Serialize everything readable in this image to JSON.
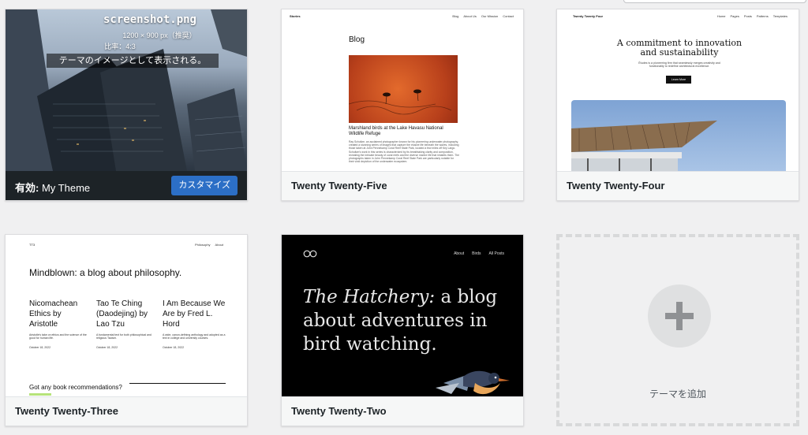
{
  "colors": {
    "active_bar": "#1d2327",
    "customize_button": "#2c6fc6",
    "page_bg": "#f0f0f1"
  },
  "themes": [
    {
      "active_label": "有効:",
      "name": "My Theme",
      "customize_label": "カスタマイズ",
      "screenshot": {
        "filename": "screenshot.png",
        "size_line": "1200 × 900 px（推奨）",
        "ratio_line": "比率：4:3",
        "note": "テーマのイメージとして表示される。"
      }
    },
    {
      "name": "Twenty Twenty-Five",
      "screenshot": {
        "site_title": "Stories",
        "nav": [
          "Blog",
          "About Us",
          "Our Mission",
          "Contact"
        ],
        "heading": "Blog",
        "post_title": "Marshland birds at the Lake Havasu National Wildlife Refuge",
        "excerpt": "Ray Schultze, an acclaimed photographer known for his pioneering underwater photography, created a stunning series of images that capture the elusive life beneath the waves, including those taken at John Pennekamp Coral Reef State Park, located a few miles off Key Largo. Schultze's work in this series is characterized by its breathtaking clarity and composition, revealing the intricate beauty of coral reefs and the diverse marine life that inhabits them. The photographs taken in John Pennekamp Coral Reef State Park are particularly notable for their vivid depiction of the underwater ecosystem."
      }
    },
    {
      "name": "Twenty Twenty-Four",
      "screenshot": {
        "site_title": "Twenty Twenty Four",
        "nav": [
          "Home",
          "Pages",
          "Posts",
          "Patterns",
          "Templates"
        ],
        "headline": "A commitment to innovation and sustainability",
        "sub": "Études is a pioneering firm that seamlessly merges creativity and functionality to redefine architectural excellence.",
        "button": "Learn More"
      }
    },
    {
      "name": "Twenty Twenty-Three",
      "screenshot": {
        "site_title": "TT3",
        "nav": [
          "Philosophy",
          "About"
        ],
        "headline": "Mindblown: a blog about philosophy.",
        "posts": [
          {
            "title": "Nicomachean Ethics by Aristotle",
            "excerpt": "Aristotle's take on ethics and the science of the good for human life.",
            "date": "October 18, 2022"
          },
          {
            "title": "Tao Te Ching (Daodejing) by Lao Tzu",
            "excerpt": "A fundamental text for both philosophical and religious Taoism.",
            "date": "October 18, 2022"
          },
          {
            "title": "I Am Because We Are by Fred L. Hord",
            "excerpt": "A wide, canon-defining anthology and adopted as a text in college and university courses.",
            "date": "October 18, 2022"
          }
        ],
        "footer_question": "Got any book recommendations?"
      }
    },
    {
      "name": "Twenty Twenty-Two",
      "screenshot": {
        "nav": [
          "About",
          "Birds",
          "All Posts"
        ],
        "headline_italic": "The Hatchery:",
        "headline_rest": "a blog about adventures in bird watching."
      }
    }
  ],
  "add_theme": {
    "label": "テーマを追加"
  }
}
